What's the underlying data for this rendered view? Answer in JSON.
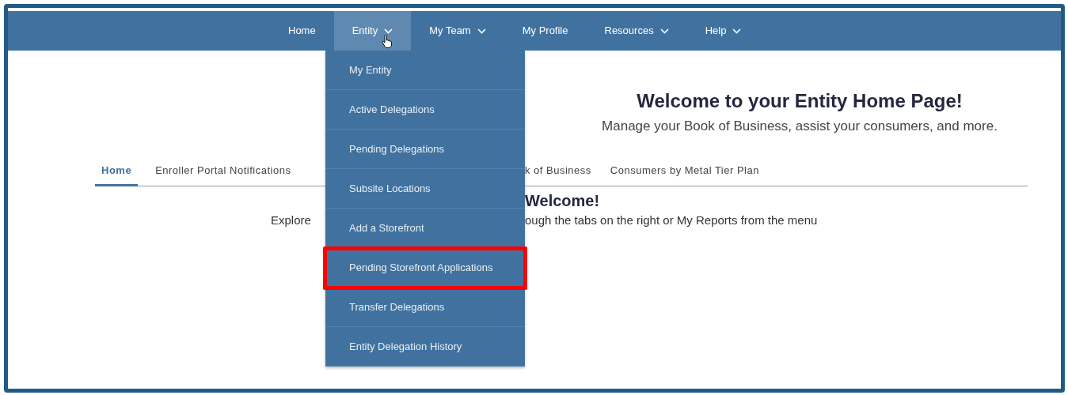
{
  "nav": {
    "items": [
      {
        "label": "Home",
        "has_dropdown": false,
        "selected": false
      },
      {
        "label": "Entity",
        "has_dropdown": true,
        "selected": true
      },
      {
        "label": "My Team",
        "has_dropdown": true,
        "selected": false
      },
      {
        "label": "My Profile",
        "has_dropdown": false,
        "selected": false
      },
      {
        "label": "Resources",
        "has_dropdown": true,
        "selected": false
      },
      {
        "label": "Help",
        "has_dropdown": true,
        "selected": false
      }
    ]
  },
  "dropdown": {
    "items": [
      {
        "label": "My Entity",
        "highlighted": false
      },
      {
        "label": "Active Delegations",
        "highlighted": false
      },
      {
        "label": "Pending Delegations",
        "highlighted": false
      },
      {
        "label": "Subsite Locations",
        "highlighted": false
      },
      {
        "label": "Add a Storefront",
        "highlighted": false
      },
      {
        "label": "Pending Storefront Applications",
        "highlighted": true
      },
      {
        "label": "Transfer Delegations",
        "highlighted": false
      },
      {
        "label": "Entity Delegation History",
        "highlighted": false
      }
    ]
  },
  "hero": {
    "title": "Welcome to your Entity Home Page!",
    "subtitle": "Manage your Book of Business, assist your consumers, and more."
  },
  "tabs": {
    "before_menu": [
      {
        "label": "Home",
        "selected": true
      },
      {
        "label": "Enroller Portal Notifications",
        "selected": false
      }
    ],
    "after_menu": [
      {
        "label": "k of Business",
        "selected": false
      },
      {
        "label": "Consumers by Metal Tier Plan",
        "selected": false
      }
    ]
  },
  "welcome": {
    "heading": "Welcome!",
    "text_before": "Explore",
    "text_after": "ough the tabs on the right or My Reports from the menu"
  }
}
